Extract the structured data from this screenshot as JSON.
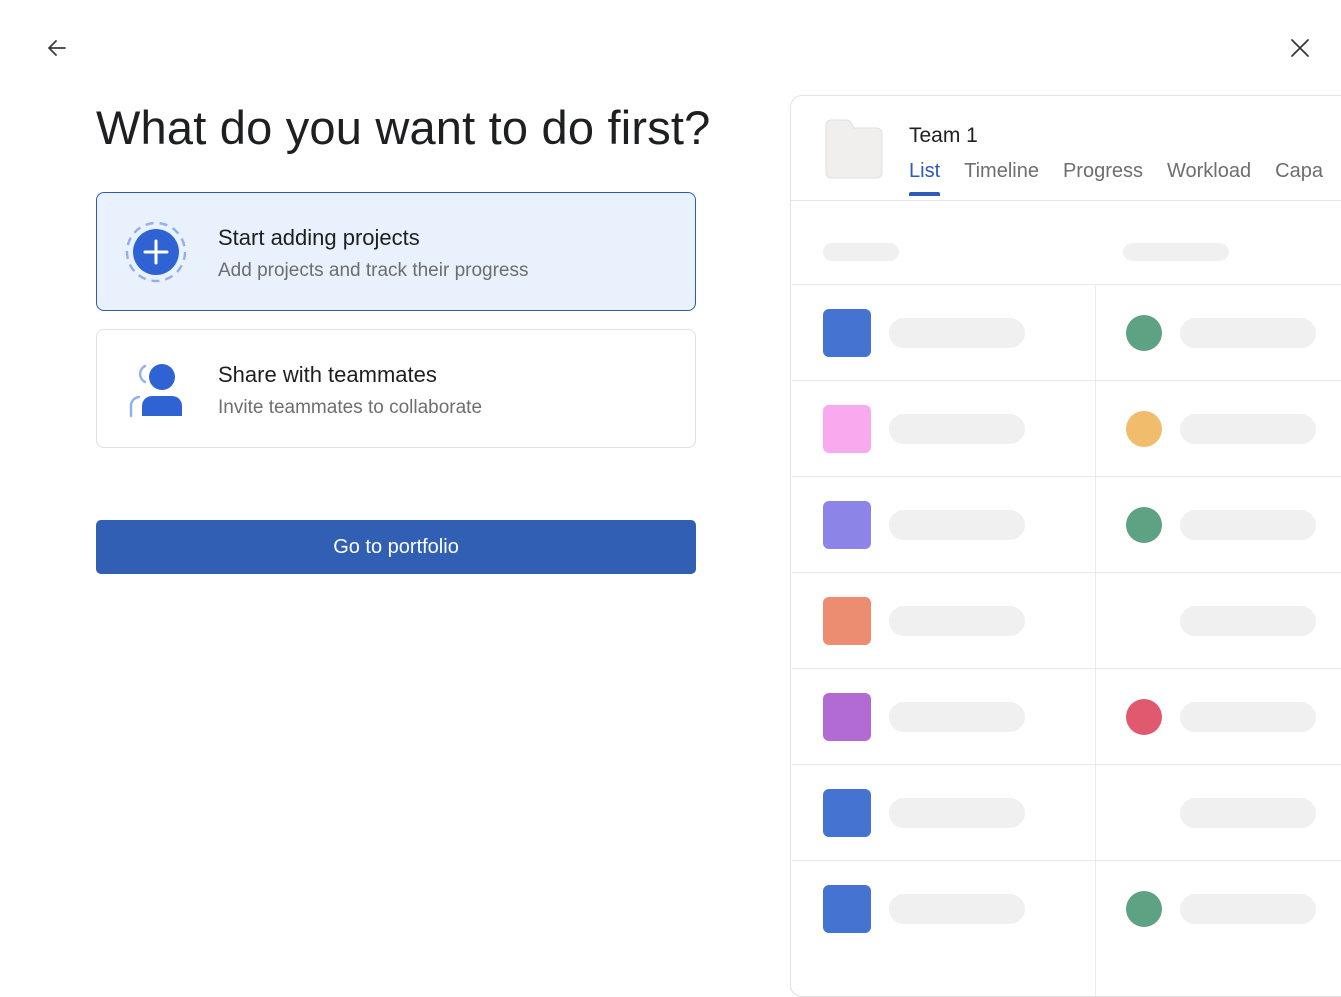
{
  "header": {
    "back_icon": "arrow-left-icon",
    "close_icon": "close-icon"
  },
  "main": {
    "heading": "What do you want to do first?",
    "options": [
      {
        "title": "Start adding projects",
        "description": "Add projects and track their progress",
        "icon": "add-circle-icon",
        "selected": true
      },
      {
        "title": "Share with teammates",
        "description": "Invite teammates to collaborate",
        "icon": "people-icon",
        "selected": false
      }
    ],
    "primary_button": "Go to portfolio"
  },
  "preview": {
    "icon": "folder-icon",
    "title": "Team 1",
    "tabs": [
      "List",
      "Timeline",
      "Progress",
      "Workload",
      "Capa"
    ],
    "active_tab": "List",
    "rows": [
      {
        "color": "#4573d2",
        "status_color": "#5da283"
      },
      {
        "color": "#f9aaef",
        "status_color": "#f1bd6c"
      },
      {
        "color": "#8d84e8",
        "status_color": "#5da283"
      },
      {
        "color": "#ec8d71",
        "status_color": null
      },
      {
        "color": "#b36bd4",
        "status_color": "#e0596f"
      },
      {
        "color": "#4573d2",
        "status_color": null
      },
      {
        "color": "#4573d2",
        "status_color": "#5da283"
      }
    ]
  },
  "colors": {
    "accent": "#305fb4",
    "selected_bg": "#e9f1fd",
    "text_primary": "#1e1f21",
    "text_secondary": "#6d6e6f"
  }
}
